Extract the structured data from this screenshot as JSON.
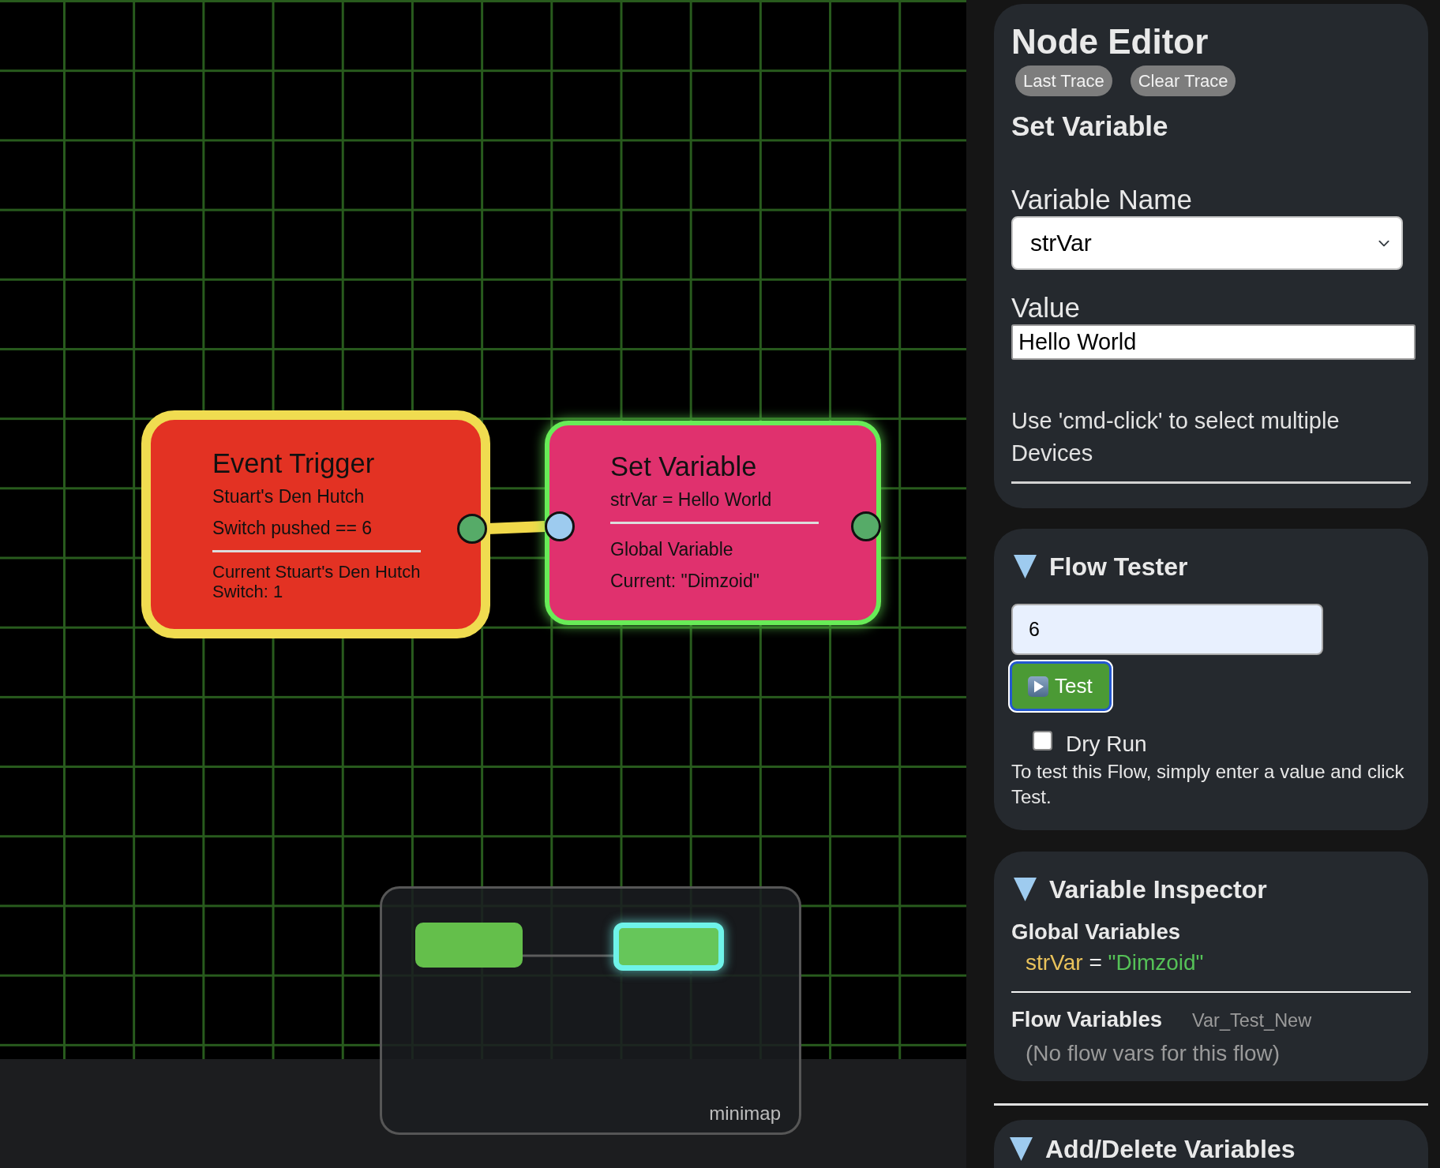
{
  "canvas": {
    "nodes": [
      {
        "kind": "trigger",
        "title": "Event Trigger",
        "lines": [
          "Stuart's Den Hutch",
          "Switch pushed == 6"
        ],
        "details": [
          "Current Stuart's Den Hutch Switch: 1"
        ],
        "selected": false,
        "ports": [
          {
            "kind": "output"
          }
        ]
      },
      {
        "kind": "action",
        "title": "Set Variable",
        "lines": [
          "strVar = Hello World"
        ],
        "details": [
          "Global Variable",
          "Current: \"Dimzoid\""
        ],
        "selected": true,
        "ports": [
          {
            "kind": "input"
          },
          {
            "kind": "output"
          }
        ]
      }
    ]
  },
  "minimap": {
    "label": "minimap"
  },
  "node_editor": {
    "title": "Node Editor",
    "buttons": [
      "Last Trace",
      "Clear Trace"
    ],
    "node_title": "Set Variable",
    "fields": [
      {
        "kind": "select",
        "label": "Variable Name",
        "value": "strVar"
      },
      {
        "kind": "text",
        "label": "Value",
        "value": "Hello World"
      }
    ],
    "help": "Use 'cmd-click' to select multiple Devices"
  },
  "flow_tester": {
    "title": "Flow Tester",
    "expanded": true,
    "input": {
      "value": "6"
    },
    "test_button": {
      "label": "Test",
      "focused": true
    },
    "dry_run": {
      "label": "Dry Run",
      "checked": false
    },
    "help": "To test this Flow, simply enter a value and click Test."
  },
  "variable_inspector": {
    "title": "Variable Inspector",
    "expanded": true,
    "global_heading": "Global Variables",
    "global_variables": [
      {
        "name": "strVar",
        "operator": "=",
        "value": "\"Dimzoid\""
      }
    ],
    "flow_heading": "Flow Variables",
    "flow_name": "Var_Test_New",
    "flow_empty": "(No flow vars for this flow)"
  },
  "add_delete_variables": {
    "title": "Add/Delete Variables",
    "expanded": true
  }
}
